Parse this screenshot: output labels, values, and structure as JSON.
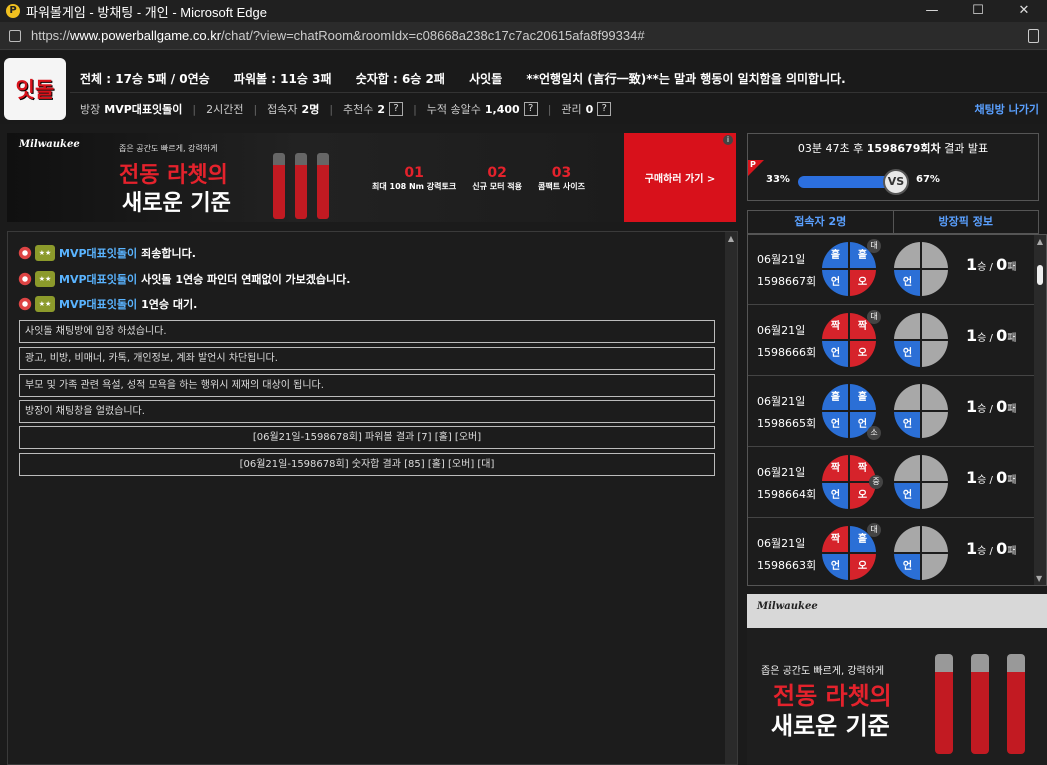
{
  "window": {
    "title": "파워볼게임 - 방채팅 - 개인 - Microsoft Edge",
    "url_prefix": "https://",
    "url_domain": "www.powerballgame.co.kr",
    "url_path": "/chat/?view=chatRoom&roomIdx=c08668a238c17c7ac20615afa8f99334#"
  },
  "header": {
    "logo_text": "잇돌",
    "stats": {
      "total": "전체 : 17승 5패 / 0연승",
      "powerball": "파워볼 : 11승 3패",
      "sum": "숫자합 : 6승 2패",
      "room": "사잇돌",
      "motto": "**언행일치 (言行一致)**는 말과 행동이 일치함을 의미합니다."
    },
    "room_info": {
      "owner_label": "방장",
      "owner": "MVP대표잇돌이",
      "duration": "2시간전",
      "users_label": "접속자",
      "users": "2명",
      "recommend_label": "추천수",
      "recommend": "2",
      "cumulative_label": "누적 송알수",
      "cumulative": "1,400",
      "manage_label": "관리",
      "manage": "0",
      "help": "?"
    },
    "exit_label": "채팅방 나가기"
  },
  "ad_top": {
    "brand": "Milwaukee",
    "small": "좁은 공간도 빠르게, 강력하게",
    "headline1": "전동 라쳇의",
    "headline2": "새로운 기준",
    "features": [
      {
        "n": "01",
        "t": "최대 108 Nm 강력토크"
      },
      {
        "n": "02",
        "t": "신규 모터 적용"
      },
      {
        "n": "03",
        "t": "콤팩트 사이즈"
      }
    ],
    "cta": "구매하러 가기 >",
    "info": "i"
  },
  "chat": {
    "messages": [
      {
        "badge": "★★",
        "name": "MVP대표잇돌이",
        "text": "죄송합니다."
      },
      {
        "badge": "★★",
        "name": "MVP대표잇돌이",
        "text": "사잇돌 1연승 파인더 연패없이 가보겠습니다."
      },
      {
        "badge": "★★",
        "name": "MVP대표잇돌이",
        "text": "1연승 대기."
      }
    ],
    "notices": [
      "사잇돌 채팅방에 입장 하셨습니다.",
      "광고, 비방, 비매너, 카톡, 개인정보, 계좌 발언시 차단됩니다.",
      "부모 및 가족 관련 욕설, 성적 모욕을 하는 행위시 제재의 대상이 됩니다.",
      "방장이 채팅창을 얼렸습니다."
    ],
    "results": [
      "[06월21일-1598678회] 파워볼 결과 [7] [홀] [오버]",
      "[06월21일-1598678회] 숫자합 결과 [85] [홀] [오버] [대]"
    ]
  },
  "result_panel": {
    "countdown": "03분 47초 후",
    "round": "1598679회차",
    "suffix": "결과 발표",
    "left_pct": "33%",
    "right_pct": "67%",
    "vs": "VS",
    "flag": "P"
  },
  "tabs": [
    "접속자 2명",
    "방장픽 정보"
  ],
  "games": [
    {
      "date": "06월21일",
      "round": "1598667회",
      "q": [
        "홀",
        "홀",
        "언",
        "오"
      ],
      "c": [
        "blue",
        "blue",
        "blue",
        "red"
      ],
      "tag": "대",
      "tagpos": "tr",
      "pick": "언",
      "wins": "1",
      "w": "승 / ",
      "losses": "0",
      "l": "패"
    },
    {
      "date": "06월21일",
      "round": "1598666회",
      "q": [
        "짝",
        "짝",
        "언",
        "오"
      ],
      "c": [
        "red",
        "red",
        "blue",
        "red"
      ],
      "tag": "대",
      "tagpos": "tr",
      "pick": "언",
      "wins": "1",
      "w": "승 / ",
      "losses": "0",
      "l": "패"
    },
    {
      "date": "06월21일",
      "round": "1598665회",
      "q": [
        "홀",
        "홀",
        "언",
        "언"
      ],
      "c": [
        "blue",
        "blue",
        "blue",
        "blue"
      ],
      "tag": "소",
      "tagpos": "br",
      "pick": "언",
      "wins": "1",
      "w": "승 / ",
      "losses": "0",
      "l": "패"
    },
    {
      "date": "06월21일",
      "round": "1598664회",
      "q": [
        "짝",
        "짝",
        "언",
        "오"
      ],
      "c": [
        "red",
        "red",
        "blue",
        "red"
      ],
      "tag": "중",
      "tagpos": "r",
      "pick": "언",
      "wins": "1",
      "w": "승 / ",
      "losses": "0",
      "l": "패"
    },
    {
      "date": "06월21일",
      "round": "1598663회",
      "q": [
        "짝",
        "홀",
        "언",
        "오"
      ],
      "c": [
        "red",
        "blue",
        "blue",
        "red"
      ],
      "tag": "대",
      "tagpos": "tr",
      "pick": "언",
      "wins": "1",
      "w": "승 / ",
      "losses": "0",
      "l": "패"
    }
  ],
  "ad_side": {
    "brand": "Milwaukee",
    "small": "좁은 공간도 빠르게, 강력하게",
    "headline1": "전동 라쳇의",
    "headline2": "새로운 기준"
  },
  "colors": {
    "accent_blue": "#2b6fd6",
    "accent_red": "#d6232b",
    "link_blue": "#5ab4ff"
  }
}
